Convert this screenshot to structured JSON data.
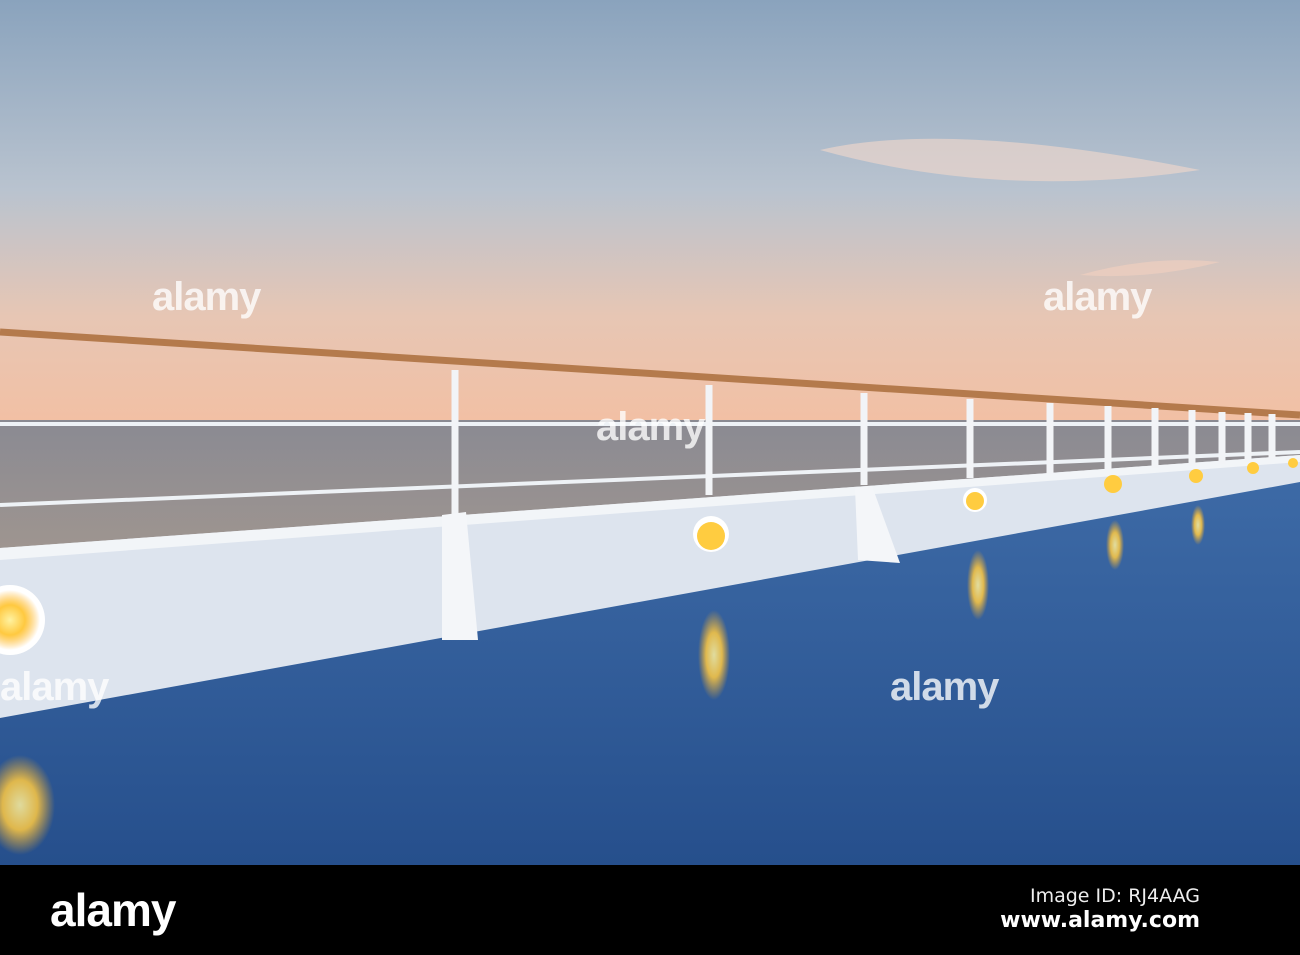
{
  "watermark": "alamy",
  "footer": {
    "logo": "alamy",
    "image_id": "Image ID: RJ4AAG",
    "website": "www.alamy.com"
  },
  "colors": {
    "sky_top": "#8fa6bd",
    "sky_horizon": "#f0c3a8",
    "sea": "#8d8a8c",
    "deck": "#2f5a94",
    "wall": "#dfe6ef",
    "handrail": "#b47a4c",
    "lamp": "#ffd34a"
  }
}
